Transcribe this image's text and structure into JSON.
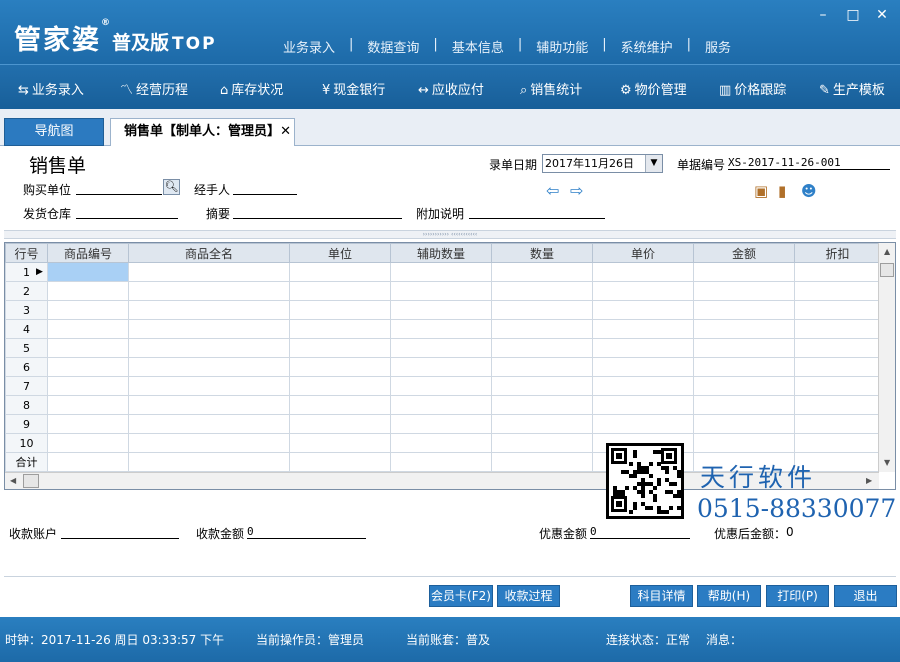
{
  "app": {
    "logo_main": "管家婆",
    "logo_edition": "普及版",
    "logo_tier": "TOP",
    "logo_reg": "®",
    "top_menu": [
      "业务录入",
      "数据查询",
      "基本信息",
      "辅助功能",
      "系统维护",
      "服务"
    ],
    "window_buttons": [
      "–",
      "□",
      "✕"
    ]
  },
  "toolbar": [
    {
      "icon": "⇆",
      "label": "业务录入"
    },
    {
      "icon": "〽",
      "label": "经营历程"
    },
    {
      "icon": "⌂",
      "label": "库存状况"
    },
    {
      "icon": "¥",
      "label": "现金银行"
    },
    {
      "icon": "↔",
      "label": "应收应付"
    },
    {
      "icon": "⌕",
      "label": "销售统计"
    },
    {
      "icon": "⚙",
      "label": "物价管理"
    },
    {
      "icon": "▥",
      "label": "价格跟踪"
    },
    {
      "icon": "✎",
      "label": "生产模板"
    }
  ],
  "tabs": {
    "nav": "导航图",
    "sale": "销售单【制单人：管理员】",
    "close": "✕"
  },
  "form": {
    "title": "销售单",
    "date_label": "录单日期",
    "date_value": "2017年11月26日",
    "docno_label": "单据编号",
    "docno_value": "XS-2017-11-26-001",
    "buyer_label": "购买单位",
    "handler_label": "经手人",
    "warehouse_label": "发货仓库",
    "summary_label": "摘要",
    "note_label": "附加说明",
    "prev_arrow": "⇦",
    "next_arrow": "⇨"
  },
  "grid": {
    "columns": [
      "行号",
      "商品编号",
      "商品全名",
      "单位",
      "辅助数量",
      "数量",
      "单价",
      "金额",
      "折扣"
    ],
    "rows": [
      "1",
      "2",
      "3",
      "4",
      "5",
      "6",
      "7",
      "8",
      "9",
      "10"
    ],
    "total_label": "合计",
    "splitter": "››››››››››› ‹‹‹‹‹‹‹‹‹‹‹"
  },
  "payment": {
    "account_label": "收款账户",
    "amount_label": "收款金额",
    "amount_value": "0",
    "discount_label": "优惠金额",
    "discount_value": "0",
    "after_label": "优惠后金额：",
    "after_value": "0"
  },
  "watermark": {
    "brand": "天行软件",
    "phone": "0515-88330077"
  },
  "buttons": {
    "member": "会员卡(F2)",
    "receipt": "收款过程",
    "subject": "科目详情",
    "help": "帮助(H)",
    "print": "打印(P)",
    "exit": "退出"
  },
  "status": {
    "clock": "时钟：2017-11-26 周日 03:33:57 下午",
    "operator": "当前操作员：管理员",
    "account": "当前账套：普及",
    "connection": "连接状态：正常",
    "message": "消息："
  }
}
